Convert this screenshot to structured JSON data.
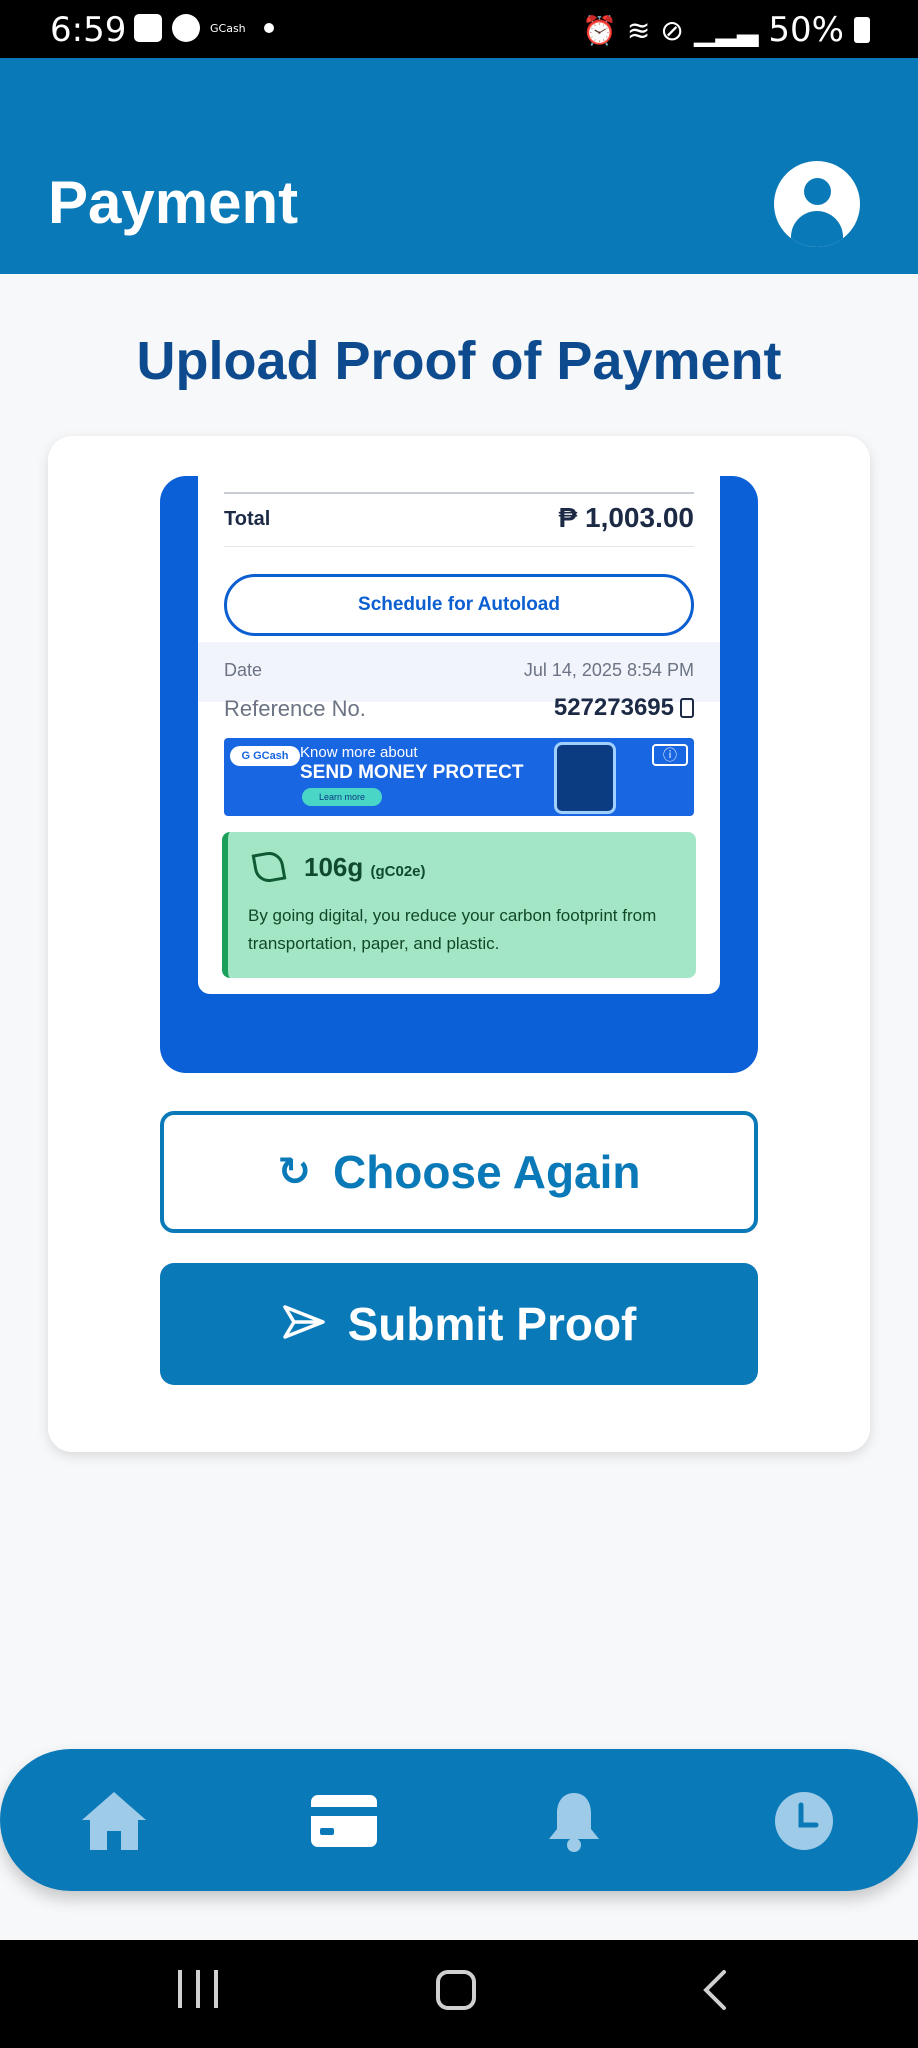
{
  "status_bar": {
    "time": "6:59",
    "notif_app": "GCash",
    "battery": "50%"
  },
  "header": {
    "title": "Payment",
    "avatar_icon": "user-avatar-icon"
  },
  "page": {
    "title": "Upload Proof of Payment"
  },
  "receipt": {
    "total_label": "Total",
    "total_value": "₱ 1,003.00",
    "autoload_label": "Schedule for Autoload",
    "date_label": "Date",
    "date_value": "Jul 14, 2025 8:54 PM",
    "reference_label": "Reference No.",
    "reference_value": "527273695",
    "banner": {
      "logo": "G GCash",
      "line1": "Know more about",
      "line2": "SEND MONEY PROTECT",
      "button": "Learn more"
    },
    "carbon": {
      "value": "106g",
      "unit": "(gC02e)",
      "text": "By going digital, you reduce your carbon footprint from transportation, paper, and plastic."
    }
  },
  "actions": {
    "choose_again": "Choose Again",
    "submit_proof": "Submit Proof"
  },
  "bottom_nav": {
    "items": [
      {
        "icon": "home-icon",
        "active": false
      },
      {
        "icon": "card-icon",
        "active": true
      },
      {
        "icon": "bell-icon",
        "active": false
      },
      {
        "icon": "clock-icon",
        "active": false
      }
    ]
  },
  "colors": {
    "primary": "#0a79b8",
    "title_blue": "#0d4a8e",
    "preview_blue": "#0b60d7",
    "carbon_green": "#a2e6c6"
  }
}
